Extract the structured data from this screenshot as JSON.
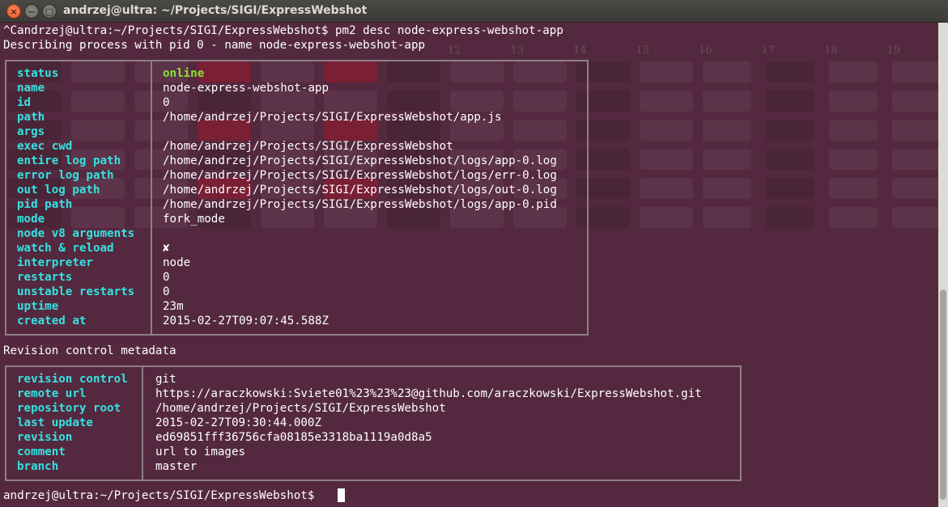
{
  "window": {
    "title": "andrzej@ultra: ~/Projects/SIGI/ExpressWebshot",
    "buttons": {
      "close": "×",
      "minimize": "−",
      "maximize": "□"
    }
  },
  "terminal": {
    "command_line": "^Candrzej@ultra:~/Projects/SIGI/ExpressWebshot$ pm2 desc node-express-webshot-app",
    "describing_line": "Describing process with pid 0 - name node-express-webshot-app",
    "process_table": [
      {
        "key": "status",
        "value": "online"
      },
      {
        "key": "name",
        "value": "node-express-webshot-app"
      },
      {
        "key": "id",
        "value": "0"
      },
      {
        "key": "path",
        "value": "/home/andrzej/Projects/SIGI/ExpressWebshot/app.js"
      },
      {
        "key": "args",
        "value": ""
      },
      {
        "key": "exec cwd",
        "value": "/home/andrzej/Projects/SIGI/ExpressWebshot"
      },
      {
        "key": "entire log path",
        "value": "/home/andrzej/Projects/SIGI/ExpressWebshot/logs/app-0.log"
      },
      {
        "key": "error log path",
        "value": "/home/andrzej/Projects/SIGI/ExpressWebshot/logs/err-0.log"
      },
      {
        "key": "out log path",
        "value": "/home/andrzej/Projects/SIGI/ExpressWebshot/logs/out-0.log"
      },
      {
        "key": "pid path",
        "value": "/home/andrzej/Projects/SIGI/ExpressWebshot/logs/app-0.pid"
      },
      {
        "key": "mode",
        "value": "fork_mode"
      },
      {
        "key": "node v8 arguments",
        "value": ""
      },
      {
        "key": "watch & reload",
        "value": "✘"
      },
      {
        "key": "interpreter",
        "value": "node"
      },
      {
        "key": "restarts",
        "value": "0"
      },
      {
        "key": "unstable restarts",
        "value": "0"
      },
      {
        "key": "uptime",
        "value": "23m"
      },
      {
        "key": "created at",
        "value": "2015-02-27T09:07:45.588Z"
      }
    ],
    "revision_heading": "Revision control metadata",
    "revision_table": [
      {
        "key": "revision control",
        "value": "git"
      },
      {
        "key": "remote url",
        "value": "https://araczkowski:Sviete01%23%23%23@github.com/araczkowski/ExpressWebshot.git"
      },
      {
        "key": "repository root",
        "value": "/home/andrzej/Projects/SIGI/ExpressWebshot"
      },
      {
        "key": "last update",
        "value": "2015-02-27T09:30:44.000Z"
      },
      {
        "key": "revision",
        "value": "ed69851fff36756cfa08185e3318ba1119a0d8a5"
      },
      {
        "key": "comment",
        "value": "url to images"
      },
      {
        "key": "branch",
        "value": "master"
      }
    ],
    "prompt": "andrzej@ultra:~/Projects/SIGI/ExpressWebshot$ "
  },
  "background_calendar": {
    "day_numbers": [
      "12",
      "13",
      "14",
      "15",
      "16",
      "17",
      "18",
      "19"
    ]
  },
  "colors": {
    "terminal_bg": "#300a24",
    "key_color": "#34e2e2",
    "online_color": "#8ae234",
    "text_color": "#ffffff",
    "border_color": "#8e7f89"
  }
}
